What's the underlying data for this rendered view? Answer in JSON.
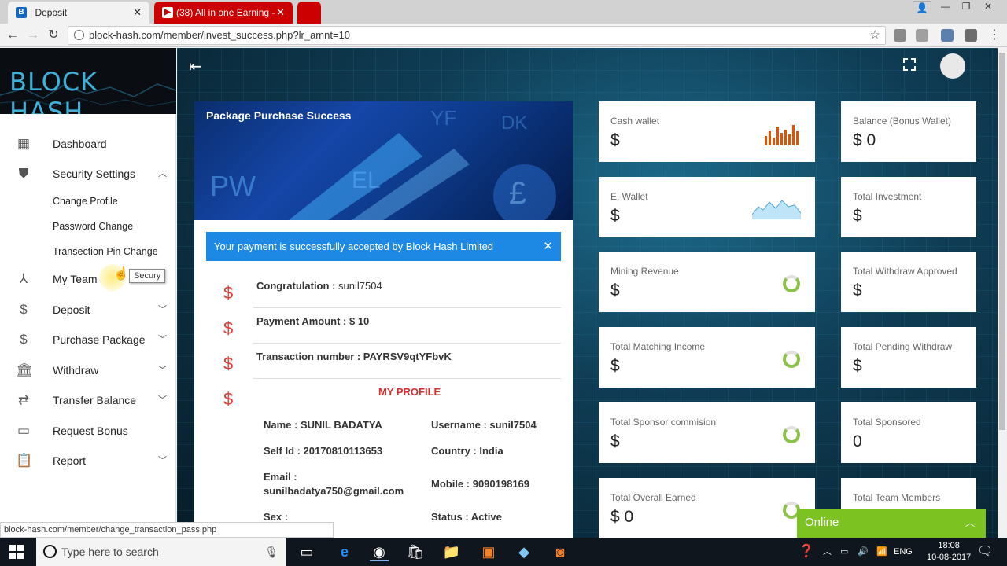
{
  "browser": {
    "tabs": [
      {
        "title": "| Deposit",
        "favicon": "B",
        "active": true
      },
      {
        "title": "(38) All in one Earning -",
        "favicon": "▶",
        "active": false
      },
      {
        "title": "",
        "favicon": "",
        "active": false
      }
    ],
    "url": "block-hash.com/member/invest_success.php?lr_amnt=10",
    "status_url": "block-hash.com/member/change_transaction_pass.php"
  },
  "sidebar": {
    "logo_text": "BLOCK HASH",
    "items": [
      {
        "label": "Dashboard",
        "icon": "dashboard-icon"
      },
      {
        "label": "Security Settings",
        "icon": "shield-icon",
        "expanded": true
      },
      {
        "label": "My Team",
        "icon": "team-icon"
      },
      {
        "label": "Deposit",
        "icon": "dollar-icon"
      },
      {
        "label": "Purchase Package",
        "icon": "dollar-icon"
      },
      {
        "label": "Withdraw",
        "icon": "bank-icon"
      },
      {
        "label": "Transfer Balance",
        "icon": "transfer-icon"
      },
      {
        "label": "Request Bonus",
        "icon": "wallet-icon"
      },
      {
        "label": "Report",
        "icon": "clipboard-icon"
      }
    ],
    "subitems": [
      "Change Profile",
      "Password Change",
      "Transection Pin Change"
    ],
    "tooltip": "Secury"
  },
  "panel": {
    "banner_title": "Package Purchase Success",
    "alert": "Your payment is successfully accepted by Block Hash Limited",
    "rows": [
      {
        "label": "Congratulation :",
        "value": "sunil7504"
      },
      {
        "label": "Payment Amount : $ 10",
        "value": ""
      },
      {
        "label": "Transaction number : PAYRSV9qtYFbvK",
        "value": ""
      }
    ],
    "profile_heading": "MY PROFILE",
    "profile": {
      "name": "Name : SUNIL BADATYA",
      "username": "Username : sunil7504",
      "self_id": "Self Id : 20170810113653",
      "country": "Country : India",
      "email_label": "Email :",
      "email": "sunilbadatya750@gmail.com",
      "mobile": "Mobile : 9090198169",
      "sex": "Sex :",
      "status": "Status : Active"
    }
  },
  "cards": [
    {
      "title": "Cash wallet",
      "value": "$",
      "graphic": "bar-chart"
    },
    {
      "title": "Balance (Bonus Wallet)",
      "value": "$ 0"
    },
    {
      "title": "E. Wallet",
      "value": "$",
      "graphic": "sparkline"
    },
    {
      "title": "Total Investment",
      "value": "$"
    },
    {
      "title": "Mining Revenue",
      "value": "$",
      "graphic": "donut"
    },
    {
      "title": "Total Withdraw Approved",
      "value": "$"
    },
    {
      "title": "Total Matching Income",
      "value": "$",
      "graphic": "donut"
    },
    {
      "title": "Total Pending Withdraw",
      "value": "$"
    },
    {
      "title": "Total Sponsor commision",
      "value": "$",
      "graphic": "donut"
    },
    {
      "title": "Total Sponsored",
      "value": "0"
    },
    {
      "title": "Total Overall Earned",
      "value": "$ 0",
      "graphic": "donut"
    },
    {
      "title": "Total Team Members",
      "value": ""
    }
  ],
  "chat": {
    "label": "Online"
  },
  "taskbar": {
    "search_placeholder": "Type here to search",
    "language": "ENG",
    "time": "18:08",
    "date": "10-08-2017"
  },
  "colors": {
    "alert_blue": "#1e88e5",
    "dollar_red": "#e53935",
    "online_green": "#7cc221",
    "chart_orange": "#e65100"
  }
}
